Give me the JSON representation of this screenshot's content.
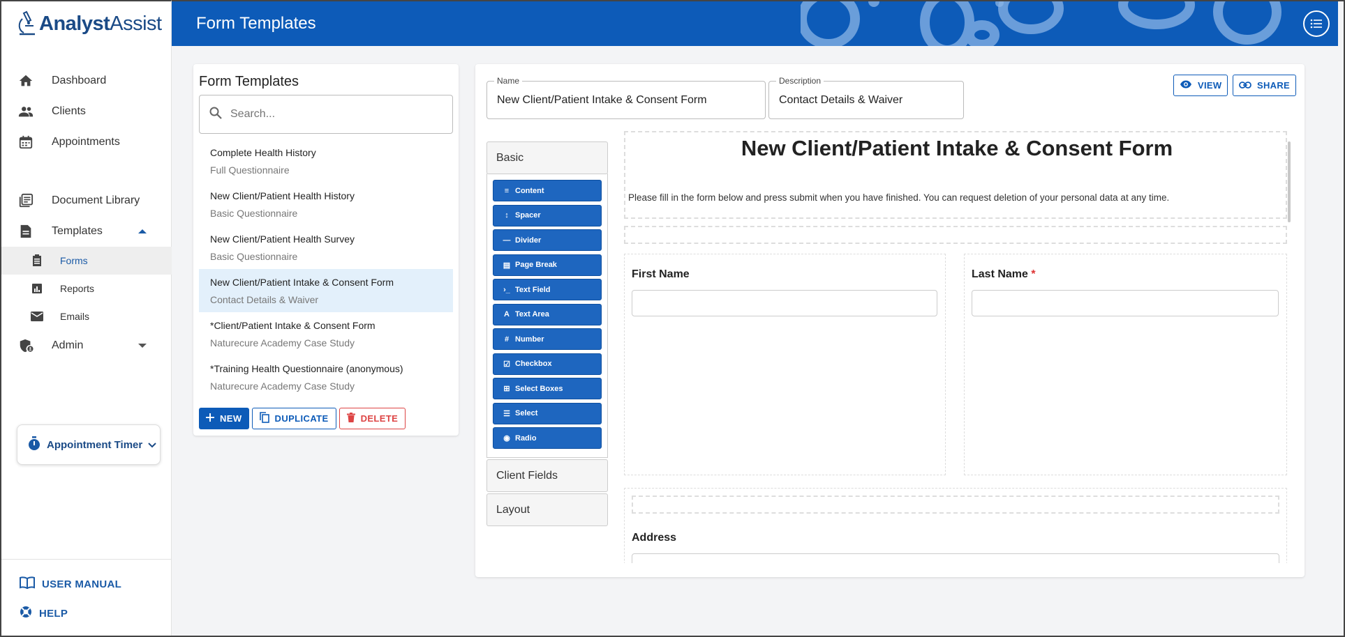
{
  "app": {
    "logo_bold": "Analyst",
    "logo_light": "Assist"
  },
  "header": {
    "title": "Form Templates"
  },
  "sidebar": {
    "items": [
      {
        "label": "Dashboard",
        "icon": "home-icon"
      },
      {
        "label": "Clients",
        "icon": "people-icon"
      },
      {
        "label": "Appointments",
        "icon": "calendar-icon"
      },
      {
        "label": "Document Library",
        "icon": "library-icon"
      },
      {
        "label": "Templates",
        "icon": "document-icon"
      }
    ],
    "subitems": [
      {
        "label": "Forms",
        "icon": "form-icon"
      },
      {
        "label": "Reports",
        "icon": "report-icon"
      },
      {
        "label": "Emails",
        "icon": "email-icon"
      }
    ],
    "admin": {
      "label": "Admin",
      "icon": "shield-icon"
    },
    "timer": {
      "label": "Appointment Timer"
    },
    "bottom": {
      "manual": "USER MANUAL",
      "help": "HELP"
    }
  },
  "templates": {
    "title": "Form Templates",
    "search_placeholder": "Search...",
    "list": [
      {
        "name": "Complete Health History",
        "desc": "Full Questionnaire"
      },
      {
        "name": "New Client/Patient Health History",
        "desc": "Basic Questionnaire"
      },
      {
        "name": "New Client/Patient Health Survey",
        "desc": "Basic Questionnaire"
      },
      {
        "name": "New Client/Patient Intake & Consent Form",
        "desc": "Contact Details & Waiver"
      },
      {
        "name": "*Client/Patient Intake & Consent Form",
        "desc": "Naturecure Academy Case Study"
      },
      {
        "name": "*Training Health Questionnaire (anonymous)",
        "desc": "Naturecure Academy Case Study"
      }
    ],
    "actions": {
      "new": "NEW",
      "duplicate": "DUPLICATE",
      "delete": "DELETE"
    }
  },
  "editor": {
    "name_label": "Name",
    "name_value": "New Client/Patient Intake & Consent Form",
    "desc_label": "Description",
    "desc_value": "Contact Details & Waiver",
    "view": "VIEW",
    "share": "SHARE",
    "groups": {
      "basic": "Basic",
      "client_fields": "Client Fields",
      "layout": "Layout"
    },
    "components": [
      {
        "label": "Content",
        "icon": "≡"
      },
      {
        "label": "Spacer",
        "icon": "↕"
      },
      {
        "label": "Divider",
        "icon": "—"
      },
      {
        "label": "Page Break",
        "icon": "▤"
      },
      {
        "label": "Text Field",
        "icon": "›_"
      },
      {
        "label": "Text Area",
        "icon": "A"
      },
      {
        "label": "Number",
        "icon": "#"
      },
      {
        "label": "Checkbox",
        "icon": "☑"
      },
      {
        "label": "Select Boxes",
        "icon": "⊞"
      },
      {
        "label": "Select",
        "icon": "☰"
      },
      {
        "label": "Radio",
        "icon": "◉"
      }
    ],
    "form": {
      "title": "New Client/Patient Intake & Consent Form",
      "intro": "Please fill in the form below and press submit when you have finished. You can request deletion of your personal data at any time.",
      "first_name": "First Name",
      "last_name": "Last Name",
      "required_mark": "*",
      "address": "Address"
    }
  }
}
